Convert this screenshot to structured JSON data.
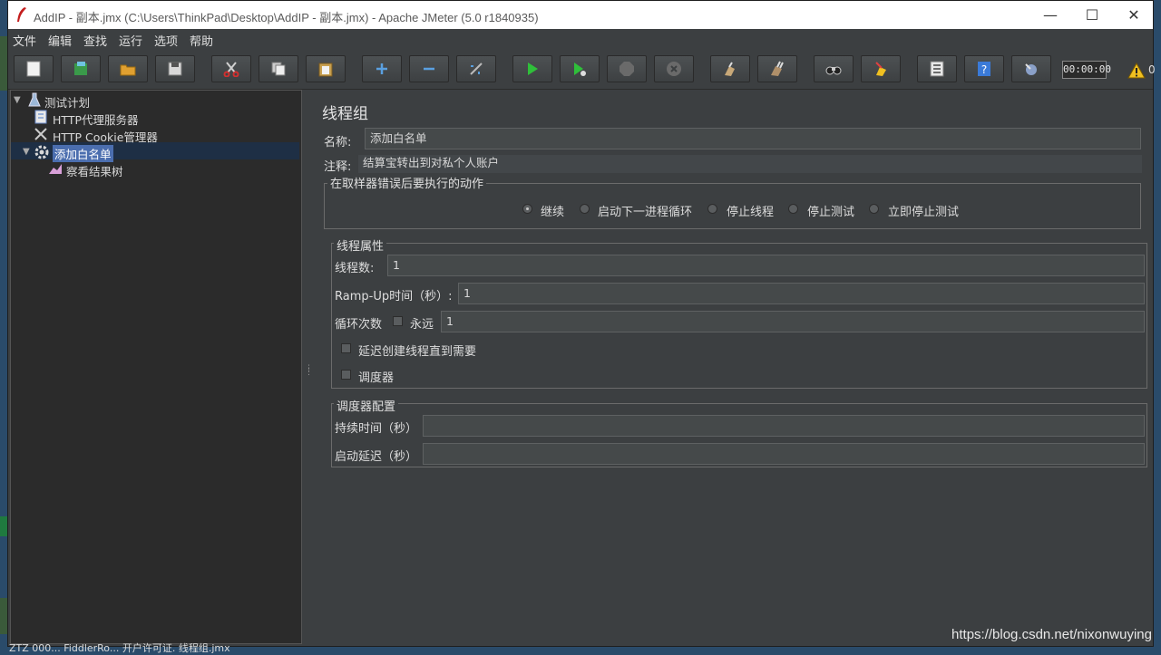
{
  "window": {
    "title": "AddIP - 副本.jmx (C:\\Users\\ThinkPad\\Desktop\\AddIP - 副本.jmx) - Apache JMeter (5.0 r1840935)"
  },
  "menu": [
    "文件",
    "编辑",
    "查找",
    "运行",
    "选项",
    "帮助"
  ],
  "toolbar": {
    "timer": "00:00:00",
    "warning_count": "0"
  },
  "tree": {
    "items": [
      "测试计划",
      "HTTP代理服务器",
      "HTTP Cookie管理器",
      "添加白名单",
      "察看结果树"
    ],
    "selected": "添加白名单"
  },
  "panel": {
    "title": "线程组",
    "name_label": "名称:",
    "name_value": "添加白名单",
    "comment_label": "注释:",
    "comment_value": "结算宝转出到对私个人账户",
    "error_group": {
      "title": "在取样器错误后要执行的动作",
      "options": [
        "继续",
        "启动下一进程循环",
        "停止线程",
        "停止测试",
        "立即停止测试"
      ],
      "selected": "继续"
    },
    "thread_props": {
      "title": "线程属性",
      "threads_label": "线程数:",
      "threads_value": "1",
      "rampup_label": "Ramp-Up时间（秒）:",
      "rampup_value": "1",
      "loop_label": "循环次数",
      "forever_label": "永远",
      "loop_value": "1",
      "delay_label": "延迟创建线程直到需要",
      "scheduler_label": "调度器"
    },
    "scheduler": {
      "title": "调度器配置",
      "duration_label": "持续时间（秒）",
      "duration_value": "",
      "startup_delay_label": "启动延迟（秒）",
      "startup_delay_value": ""
    }
  },
  "watermark": "https://blog.csdn.net/nixonwuying",
  "taskbar": "ZTZ 000...     FiddlerRo...     开户许可证.     线程组.jmx"
}
